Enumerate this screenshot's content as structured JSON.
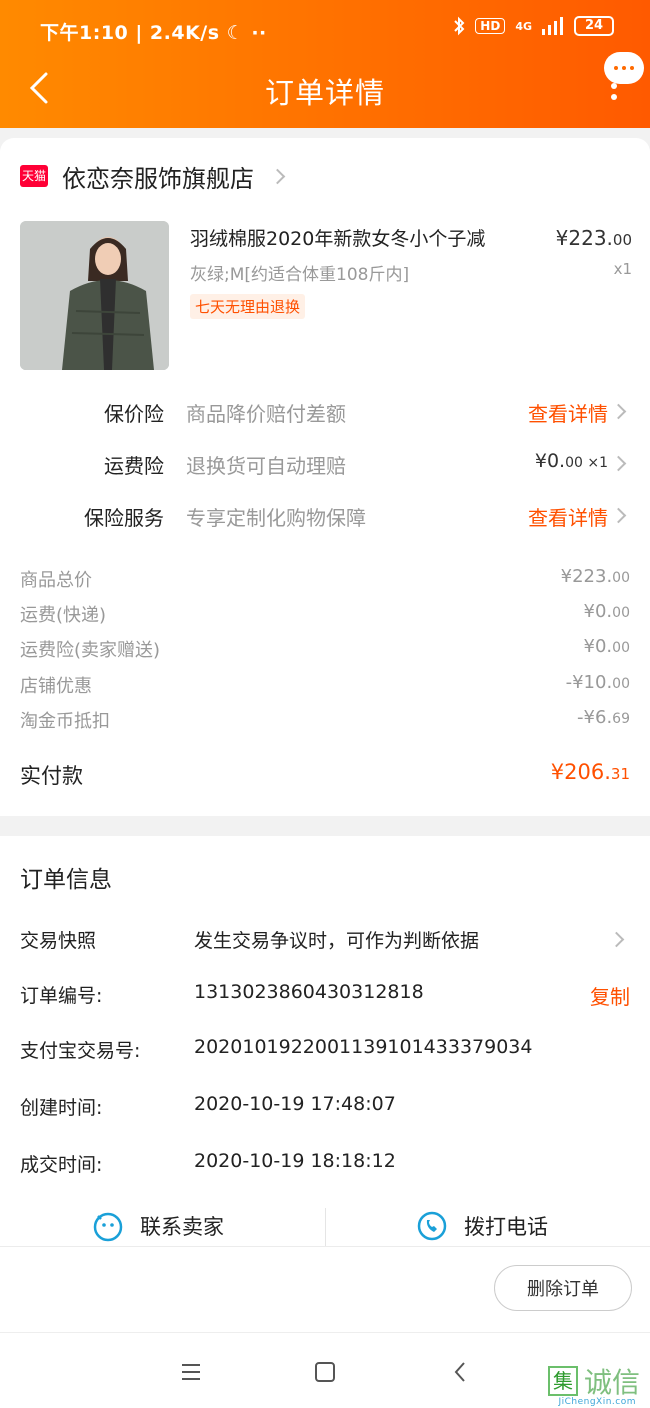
{
  "status_bar": {
    "left": "下午1:10 | 2.4K/s ☾ ··",
    "network": "4G",
    "hd": "HD",
    "battery": "24"
  },
  "header": {
    "title": "订单详情"
  },
  "shop": {
    "badge": "天猫",
    "name": "依恋奈服饰旗舰店"
  },
  "product": {
    "title": "羽绒棉服2020年新款女冬小个子减",
    "sku": "灰绿;M[约适合体重108斤内]",
    "tag": "七天无理由退换",
    "price_main": "¥223.",
    "price_decimal": "00",
    "qty": "x1"
  },
  "services": [
    {
      "label": "保价险",
      "desc": "商品降价赔付差额",
      "action": "查看详情"
    },
    {
      "label": "运费险",
      "desc": "退换货可自动理赔",
      "action_main": "¥0.",
      "action_decimal": "00",
      "action_qty": " ×1"
    },
    {
      "label": "保险服务",
      "desc": "专享定制化购物保障",
      "action": "查看详情"
    }
  ],
  "summary": [
    {
      "label": "商品总价",
      "value_main": "¥223.",
      "value_decimal": "00"
    },
    {
      "label": "运费(快递)",
      "value_main": "¥0.",
      "value_decimal": "00"
    },
    {
      "label": "运费险(卖家赠送)",
      "value_main": "¥0.",
      "value_decimal": "00"
    },
    {
      "label": "店铺优惠",
      "value_main": "-¥10.",
      "value_decimal": "00"
    },
    {
      "label": "淘金币抵扣",
      "value_main": "-¥6.",
      "value_decimal": "69"
    }
  ],
  "paid": {
    "label": "实付款",
    "value_main": "¥206.",
    "value_decimal": "31"
  },
  "order_info": {
    "title": "订单信息",
    "snapshot_label": "交易快照",
    "snapshot_value": "发生交易争议时，可作为判断依据",
    "order_no_label": "订单编号:",
    "order_no": "1313023860430312818",
    "copy_label": "复制",
    "alipay_label": "支付宝交易号:",
    "alipay_no": "2020101922001139101433379034",
    "created_label": "创建时间:",
    "created_time": "2020-10-19 17:48:07",
    "deal_label": "成交时间:",
    "deal_time": "2020-10-19 18:18:12"
  },
  "contact": {
    "seller": "联系卖家",
    "phone": "拨打电话"
  },
  "footer": {
    "delete": "删除订单"
  },
  "watermark": {
    "text": "诚信",
    "box": "集",
    "sub": "JiChengXin.com"
  },
  "colors": {
    "accent": "#ff5000",
    "header_start": "#ff8a00",
    "header_end": "#ff5a00",
    "tmall": "#ff0036",
    "icon_blue": "#1aa0d8"
  }
}
